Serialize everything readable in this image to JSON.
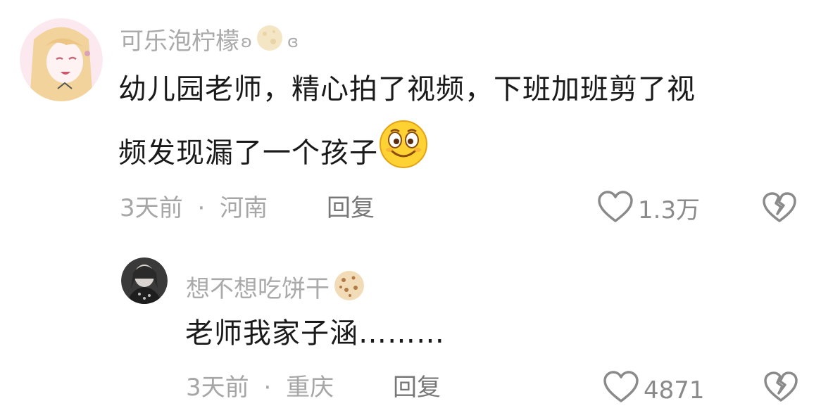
{
  "comments": [
    {
      "username": "可乐泡柠檬",
      "name_decor_left": "ʚ",
      "name_decor_right": "ɞ",
      "name_emoji": "moon-icon",
      "text_line1": "幼儿园老师，精心拍了视频，下班加班剪了视",
      "text_line2": "频发现漏了一个孩子",
      "text_emoji": "smile-emoji-icon",
      "time": "3天前",
      "separator": "·",
      "location": "河南",
      "reply_label": "回复",
      "like_count": "1.3万"
    },
    {
      "username": "想不想吃饼干",
      "name_emoji": "cookie-icon",
      "text": "老师我家子涵………",
      "time": "3天前",
      "separator": "·",
      "location": "重庆",
      "reply_label": "回复",
      "like_count": "4871"
    }
  ],
  "colors": {
    "username": "#aaaaaa",
    "text": "#1a1a1a",
    "meta": "#a6a6a6",
    "icon": "#8a8a8a"
  }
}
